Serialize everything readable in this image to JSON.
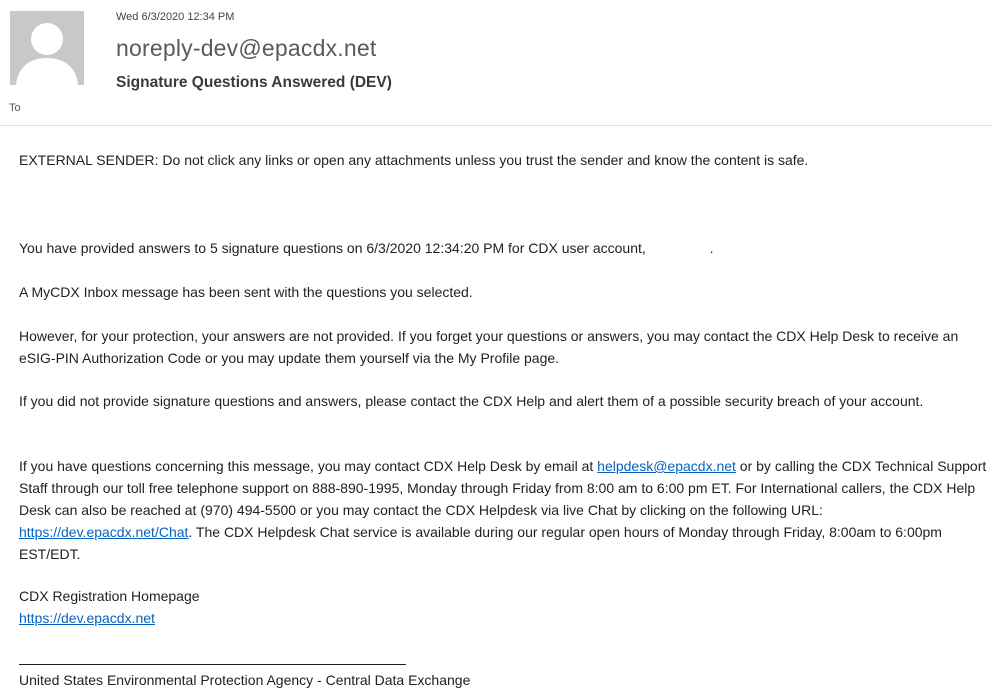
{
  "header": {
    "date": "Wed 6/3/2020 12:34 PM",
    "sender": "noreply-dev@epacdx.net",
    "subject": "Signature Questions Answered (DEV)",
    "to_label": "To",
    "avatar_icon": "person-silhouette-icon"
  },
  "body": {
    "warning": "EXTERNAL SENDER: Do not click any links or open any attachments unless you trust the sender and know the content is safe.",
    "p1_prefix": "You have provided answers to 5 signature questions on 6/3/2020 12:34:20 PM for CDX user account, ",
    "p1_suffix": ".",
    "p2": "A MyCDX Inbox message has been sent with the questions you selected.",
    "p3": "However, for your protection, your answers are not provided.  If you forget your questions or answers, you may contact the CDX Help Desk to receive an eSIG-PIN Authorization Code or you may update them yourself via the My Profile page.",
    "p4": "If you did not provide signature questions and answers, please contact the CDX Help and alert them of a possible security breach of your account.",
    "p5_a": "If you have questions concerning this message, you may contact CDX Help Desk by email at ",
    "p5_email": "helpdesk@epacdx.net",
    "p5_b": " or by calling the CDX Technical Support Staff through our toll free telephone support on  888-890-1995, Monday through Friday from 8:00 am to 6:00 pm ET. For International callers, the CDX Help Desk can also be reached at (970) 494-5500 or you may contact the CDX Helpdesk via live Chat by clicking on the following URL: ",
    "p5_chat_url": "https://dev.epacdx.net/Chat",
    "p5_c": ".  The CDX Helpdesk Chat service is available during our regular open hours of Monday through Friday, 8:00am to 6:00pm EST/EDT.",
    "homepage_label": "CDX Registration Homepage",
    "homepage_url": "https://dev.epacdx.net",
    "footer": "United States Environmental Protection Agency - Central Data Exchange"
  },
  "colors": {
    "link": "#0563c1",
    "avatar_bg": "#c8c8c8"
  }
}
